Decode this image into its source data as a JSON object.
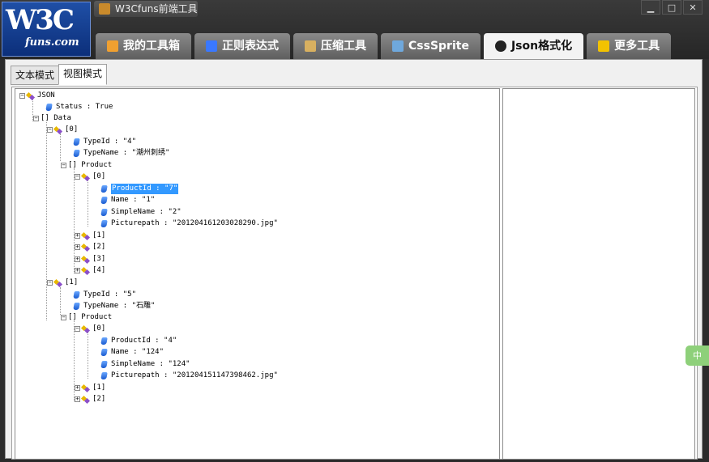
{
  "logo": {
    "main": "W3C",
    "sub": "funs.com"
  },
  "app_title": "W3Cfuns前端工具",
  "window_buttons": {
    "minimize": "▁",
    "maximize": "□",
    "close": "✕"
  },
  "tabs": [
    {
      "label": "我的工具箱",
      "icon": "home-icon"
    },
    {
      "label": "正则表达式",
      "icon": "regex-icon"
    },
    {
      "label": "压缩工具",
      "icon": "compress-icon"
    },
    {
      "label": "CssSprite",
      "icon": "sprite-icon"
    },
    {
      "label": "Json格式化",
      "icon": "json-icon"
    },
    {
      "label": "更多工具",
      "icon": "star-icon"
    }
  ],
  "subtabs": {
    "text_mode": "文本模式",
    "view_mode": "视图模式"
  },
  "tree": {
    "root": "JSON",
    "status": "Status : True",
    "data": "[] Data",
    "item0": "[0]",
    "item0_typeid": "TypeId : \"4\"",
    "item0_typename": "TypeName : \"潮州刺绣\"",
    "item0_product": "[] Product",
    "p0": "[0]",
    "p0_productid": "ProductId : \"7\"",
    "p0_name": "Name : \"1\"",
    "p0_simplename": "SimpleName : \"2\"",
    "p0_picturepath": "Picturepath : \"201204161203028290.jpg\"",
    "p1": "[1]",
    "p2": "[2]",
    "p3": "[3]",
    "p4": "[4]",
    "item1": "[1]",
    "item1_typeid": "TypeId : \"5\"",
    "item1_typename": "TypeName : \"石雕\"",
    "item1_product": "[] Product",
    "q0": "[0]",
    "q0_productid": "ProductId : \"4\"",
    "q0_name": "Name : \"124\"",
    "q0_simplename": "SimpleName : \"124\"",
    "q0_picturepath": "Picturepath : \"201204151147398462.jpg\"",
    "q1": "[1]",
    "q2": "[2]"
  },
  "side_tag": "中",
  "colors": {
    "selection": "#3399ff",
    "active_tab": "#f3f3f3",
    "chrome": "#2b2b2b"
  }
}
